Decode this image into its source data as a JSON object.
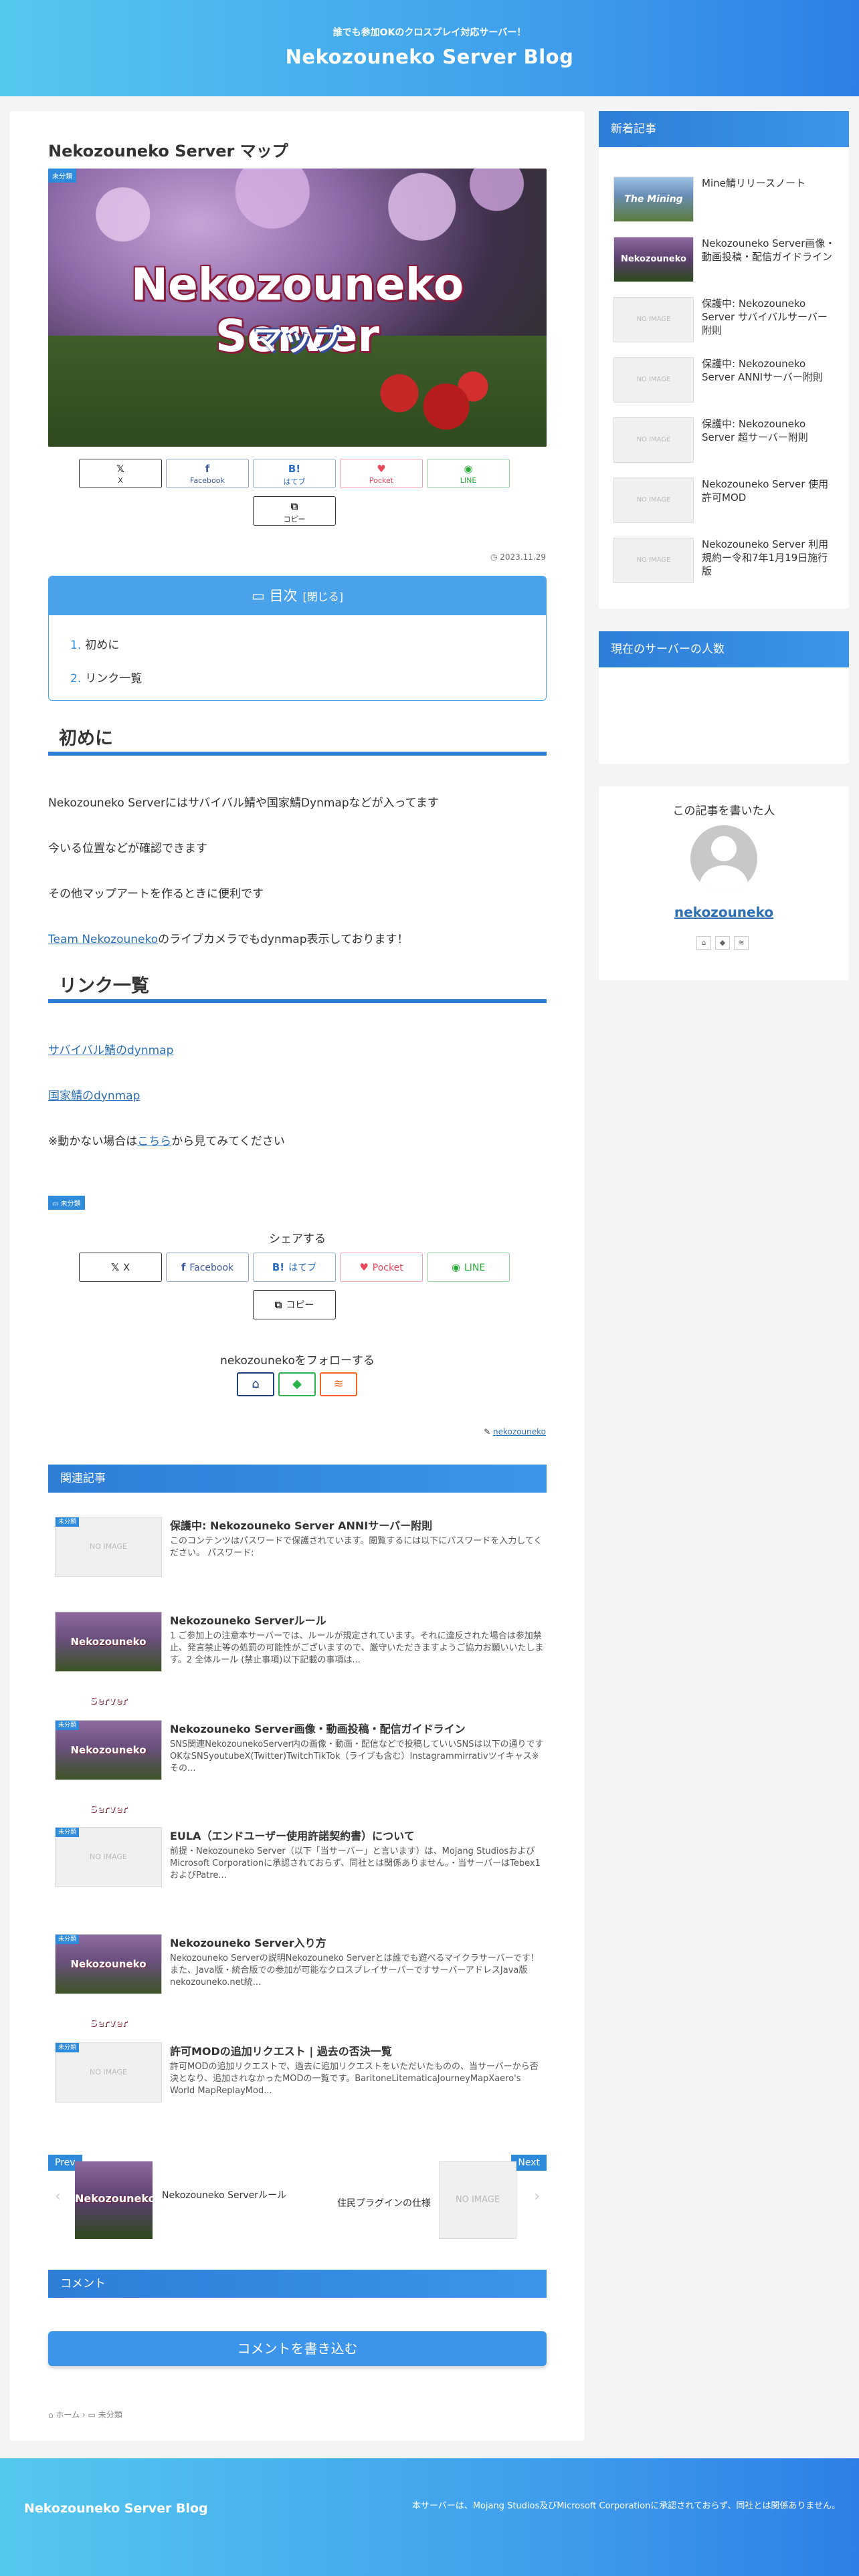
{
  "header": {
    "tagline": "誰でも参加OKのクロスプレイ対応サーバー！",
    "site_title": "Nekozouneko Server Blog"
  },
  "post": {
    "title": "Nekozouneko Server マップ",
    "category_badge": "未分類",
    "hero_title": "Nekozouneko Server",
    "hero_subtitle": "マップ",
    "date": "2023.11.29",
    "date_icon": "clock-icon"
  },
  "share_top": [
    {
      "icon": "𝕏",
      "label": "X",
      "color": "#333333"
    },
    {
      "icon": "f",
      "label": "Facebook",
      "color": "#3b5998"
    },
    {
      "icon": "B!",
      "label": "はてブ",
      "color": "#2c6ebd"
    },
    {
      "icon": "♥",
      "label": "Pocket",
      "color": "#e9475b"
    },
    {
      "icon": "◉",
      "label": "LINE",
      "color": "#27ae36"
    },
    {
      "icon": "⧉",
      "label": "コピー",
      "color": "#333333"
    }
  ],
  "toc": {
    "title": "目次",
    "toggle": "[閉じる]",
    "items": [
      {
        "num": "1.",
        "label": "初めに"
      },
      {
        "num": "2.",
        "label": "リンク一覧"
      }
    ]
  },
  "content": {
    "h2_intro": "初めに",
    "p1": "Nekozouneko Serverにはサバイバル鯖や国家鯖Dynmapなどが入ってます",
    "p2": "今いる位置などが確認できます",
    "p3": "その他マップアートを作るときに便利です",
    "p4_link": "Team Nekozouneko",
    "p4_rest": "のライブカメラでもdynmap表示しております！",
    "h2_links": "リンク一覧",
    "link1": "サバイバル鯖のdynmap",
    "link2": "国家鯖のdynmap",
    "note_pre": "※動かない場合は",
    "note_link": "こちら",
    "note_post": "から見てみてください"
  },
  "footer_area": {
    "category_tag": "未分類",
    "share_title": "シェアする",
    "follow_title": "nekozounekoをフォローする",
    "author_link": "nekozouneko"
  },
  "share_bottom": [
    {
      "icon": "𝕏",
      "label": "X",
      "color": "#333333"
    },
    {
      "icon": "f",
      "label": "Facebook",
      "color": "#3b5998"
    },
    {
      "icon": "B!",
      "label": "はてブ",
      "color": "#2c6ebd"
    },
    {
      "icon": "♥",
      "label": "Pocket",
      "color": "#e9475b"
    },
    {
      "icon": "◉",
      "label": "LINE",
      "color": "#27ae36"
    },
    {
      "icon": "⧉",
      "label": "コピー",
      "color": "#333333"
    }
  ],
  "follow_buttons": [
    {
      "icon": "⌂",
      "name": "home-icon",
      "color": "#1d3f7a"
    },
    {
      "icon": "◆",
      "name": "feedly-icon",
      "color": "#2bb24c"
    },
    {
      "icon": "≋",
      "name": "rss-icon",
      "color": "#f26522"
    }
  ],
  "related": {
    "title": "関連記事",
    "items": [
      {
        "badge": "未分類",
        "thumb": "NO IMAGE",
        "has_image": false,
        "title": "保護中: Nekozouneko Server ANNIサーバー附則",
        "excerpt": "このコンテンツはパスワードで保護されています。閲覧するには以下にパスワードを入力してください。 パスワード:"
      },
      {
        "badge": "",
        "thumb": "Nekozouneko Server",
        "has_image": true,
        "title": "Nekozouneko Serverルール",
        "excerpt": "1 ご参加上の注意本サーバーでは、ルールが規定されています。それに違反された場合は参加禁止、発言禁止等の処罰の可能性がございますので、厳守いただきますようご協力お願いいたします。2 全体ルール (禁止事項)以下記載の事項は..."
      },
      {
        "badge": "未分類",
        "thumb": "Nekozouneko Server",
        "has_image": true,
        "title": "Nekozouneko Server画像・動画投稿・配信ガイドライン",
        "excerpt": "SNS関連NekozounekoServer内の画像・動画・配信などで投稿していいSNSは以下の通りですOKなSNSyoutubeX(Twitter)TwitchTikTok（ライブも含む）Instagrammirrativツイキャス※その..."
      },
      {
        "badge": "未分類",
        "thumb": "NO IMAGE",
        "has_image": false,
        "title": "EULA（エンドユーザー使用許諾契約書）について",
        "excerpt": "前提・Nekozouneko Server（以下「当サーバー」と言います）は、Mojang StudiosおよびMicrosoft Corporationに承認されておらず、同社とは関係ありません。・当サーバーはTebex1およびPatre..."
      },
      {
        "badge": "未分類",
        "thumb": "Nekozouneko Server",
        "has_image": true,
        "title": "Nekozouneko Server入り方",
        "excerpt": "Nekozouneko Serverの説明Nekozouneko Serverとは誰でも遊べるマイクラサーバーです！また、Java版・統合版での参加が可能なクロスプレイサーバーですサーバーアドレスJava版 nekozouneko.net統..."
      },
      {
        "badge": "未分類",
        "thumb": "NO IMAGE",
        "has_image": false,
        "title": "許可MODの追加リクエスト | 過去の否決一覧",
        "excerpt": "許可MODの追加リクエストで、過去に追加リクエストをいただいたものの、当サーバーから否決となり、追加されなかったMODの一覧です。BaritoneLitematicaJourneyMapXaero's World MapReplayMod..."
      }
    ]
  },
  "pager": {
    "prev_label": "Prev",
    "prev_title": "Nekozouneko Serverルール",
    "prev_thumb": "Nekozouneko Se",
    "next_label": "Next",
    "next_title": "住民プラグインの仕様",
    "next_thumb": "NO IMAGE"
  },
  "comments": {
    "title": "コメント",
    "button": "コメントを書き込む"
  },
  "breadcrumb": {
    "home": "ホーム",
    "category": "未分類"
  },
  "sidebar": {
    "new_title": "新着記事",
    "new_items": [
      {
        "thumb": "The Mining",
        "type": "mine",
        "title": "Mine鯖リリースノート"
      },
      {
        "thumb": "Nekozouneko Server",
        "type": "img",
        "title": "Nekozouneko Server画像・動画投稿・配信ガイドライン"
      },
      {
        "thumb": "NO IMAGE",
        "type": "none",
        "title": "保護中: Nekozouneko Server サバイバルサーバー附則"
      },
      {
        "thumb": "NO IMAGE",
        "type": "none",
        "title": "保護中: Nekozouneko Server ANNIサーバー附則"
      },
      {
        "thumb": "NO IMAGE",
        "type": "none",
        "title": "保護中: Nekozouneko Server 超サーバー附則"
      },
      {
        "thumb": "NO IMAGE",
        "type": "none",
        "title": "Nekozouneko Server 使用許可MOD"
      },
      {
        "thumb": "NO IMAGE",
        "type": "none",
        "title": "Nekozouneko Server 利用規約ー令和7年1月19日施行版"
      }
    ],
    "players_title": "現在のサーバーの人数",
    "author_box_title": "この記事を書いた人",
    "author_name": "nekozouneko"
  },
  "footer": {
    "site_title": "Nekozouneko Server Blog",
    "copyright": "本サーバーは、Mojang Studios及びMicrosoft Corporationに承認されておらず、同社とは関係ありません。"
  }
}
